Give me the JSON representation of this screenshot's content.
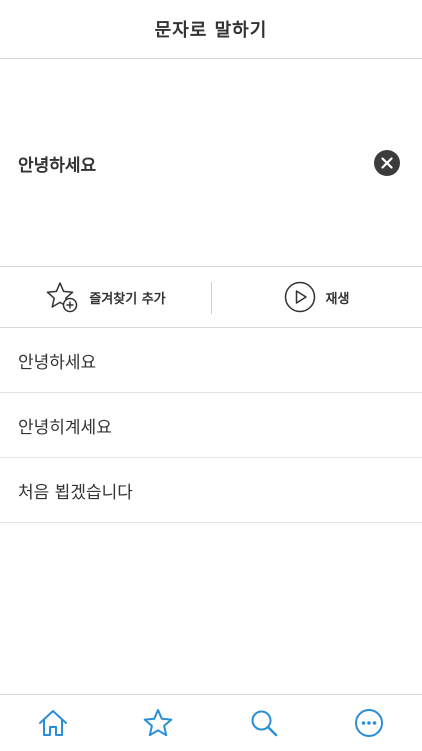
{
  "header": {
    "title": "문자로 말하기"
  },
  "input": {
    "text": "안녕하세요"
  },
  "actions": {
    "favorite_label": "즐겨찾기 추가",
    "play_label": "재생"
  },
  "suggestions": [
    {
      "text": "안녕하세요"
    },
    {
      "text": "안녕히계세요"
    },
    {
      "text": "처음 뵙겠습니다"
    }
  ],
  "tabbar": {
    "items": [
      {
        "icon": "home-icon"
      },
      {
        "icon": "star-icon"
      },
      {
        "icon": "search-icon"
      },
      {
        "icon": "more-icon"
      }
    ]
  },
  "colors": {
    "accent": "#2a8fd6",
    "text": "#333333",
    "divider": "#d9d9d9"
  }
}
